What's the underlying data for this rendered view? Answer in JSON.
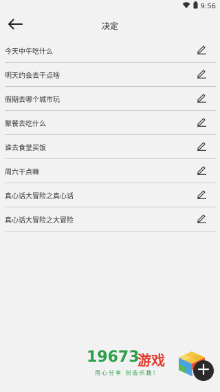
{
  "status_bar": {
    "time": "9:56",
    "wifi_icon": "wifi-icon",
    "battery_icon": "battery-icon"
  },
  "header": {
    "title": "决定",
    "back_icon": "arrow-left-icon"
  },
  "items": [
    {
      "label": "今天中午吃什么"
    },
    {
      "label": "明天约会去干点啥"
    },
    {
      "label": "假期去哪个城市玩"
    },
    {
      "label": "聚餐去吃什么"
    },
    {
      "label": "谁去食堂买饭"
    },
    {
      "label": "周六干点嘛"
    },
    {
      "label": "真心话大冒险之真心话"
    },
    {
      "label": "真心话大冒险之大冒险"
    }
  ],
  "watermark": {
    "number": "19673",
    "game": "游戏",
    "slogan": "用心分享 创造乐趣!"
  },
  "fab": {
    "icon": "plus-icon"
  },
  "colors": {
    "background": "#f2f2f2",
    "brand_green": "#2b9f4a",
    "brand_red": "#e03b2d"
  }
}
